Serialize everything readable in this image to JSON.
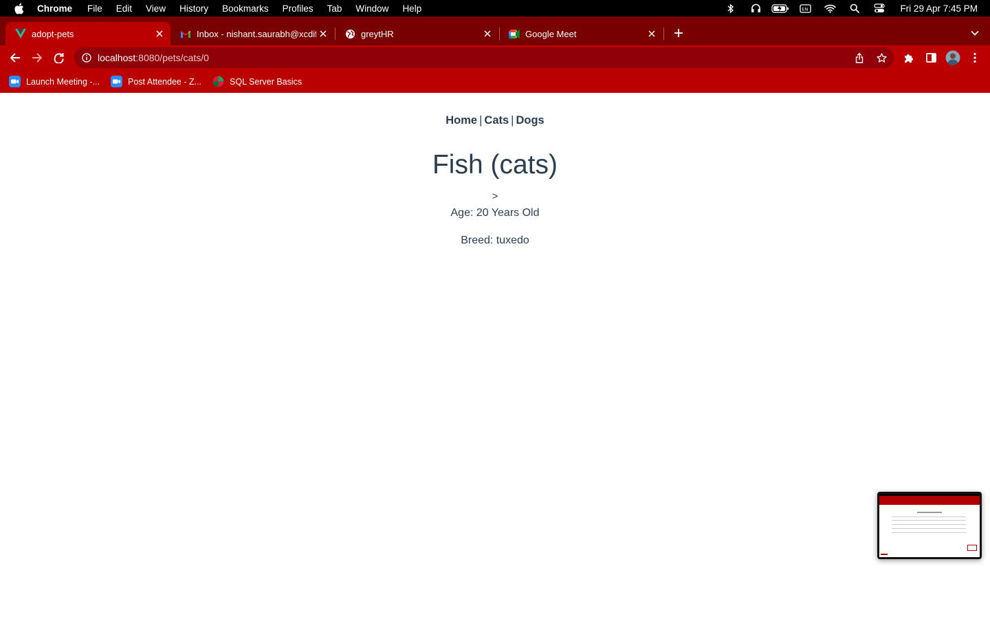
{
  "menubar": {
    "app_name": "Chrome",
    "items": [
      "File",
      "Edit",
      "View",
      "History",
      "Bookmarks",
      "Profiles",
      "Tab",
      "Window",
      "Help"
    ],
    "clock": "Fri 29 Apr  7:45 PM",
    "status_icons": [
      "bluetooth-icon",
      "headphones-icon",
      "battery-charging-icon",
      "keyboard-input-icon",
      "wifi-icon",
      "spotlight-search-icon",
      "control-center-icon"
    ]
  },
  "tabs": [
    {
      "title": "adopt-pets",
      "icon": "vue-icon",
      "active": true
    },
    {
      "title": "Inbox - nishant.saurabh@xcdify",
      "icon": "gmail-icon",
      "active": false
    },
    {
      "title": "greytHR",
      "icon": "globe-icon",
      "active": false
    },
    {
      "title": "Google Meet",
      "icon": "google-meet-icon",
      "active": false
    }
  ],
  "address_bar": {
    "host": "localhost",
    "path": ":8080/pets/cats/0"
  },
  "bookmarks": [
    {
      "label": "Launch Meeting -...",
      "icon": "zoom-icon"
    },
    {
      "label": "Post Attendee - Z...",
      "icon": "zoom-icon"
    },
    {
      "label": "SQL Server Basics",
      "icon": "sql-server-icon"
    }
  ],
  "page": {
    "nav": {
      "home": "Home",
      "cats": "Cats",
      "dogs": "Dogs",
      "separator": "|"
    },
    "title": "Fish (cats)",
    "stray_text": ">",
    "age": "Age: 20 Years Old",
    "breed": "Breed: tuxedo"
  },
  "colors": {
    "tabstrip": "#790000",
    "toolbar": "#ba0000",
    "omnibox": "#8f0008",
    "text": "#2c3e50"
  }
}
